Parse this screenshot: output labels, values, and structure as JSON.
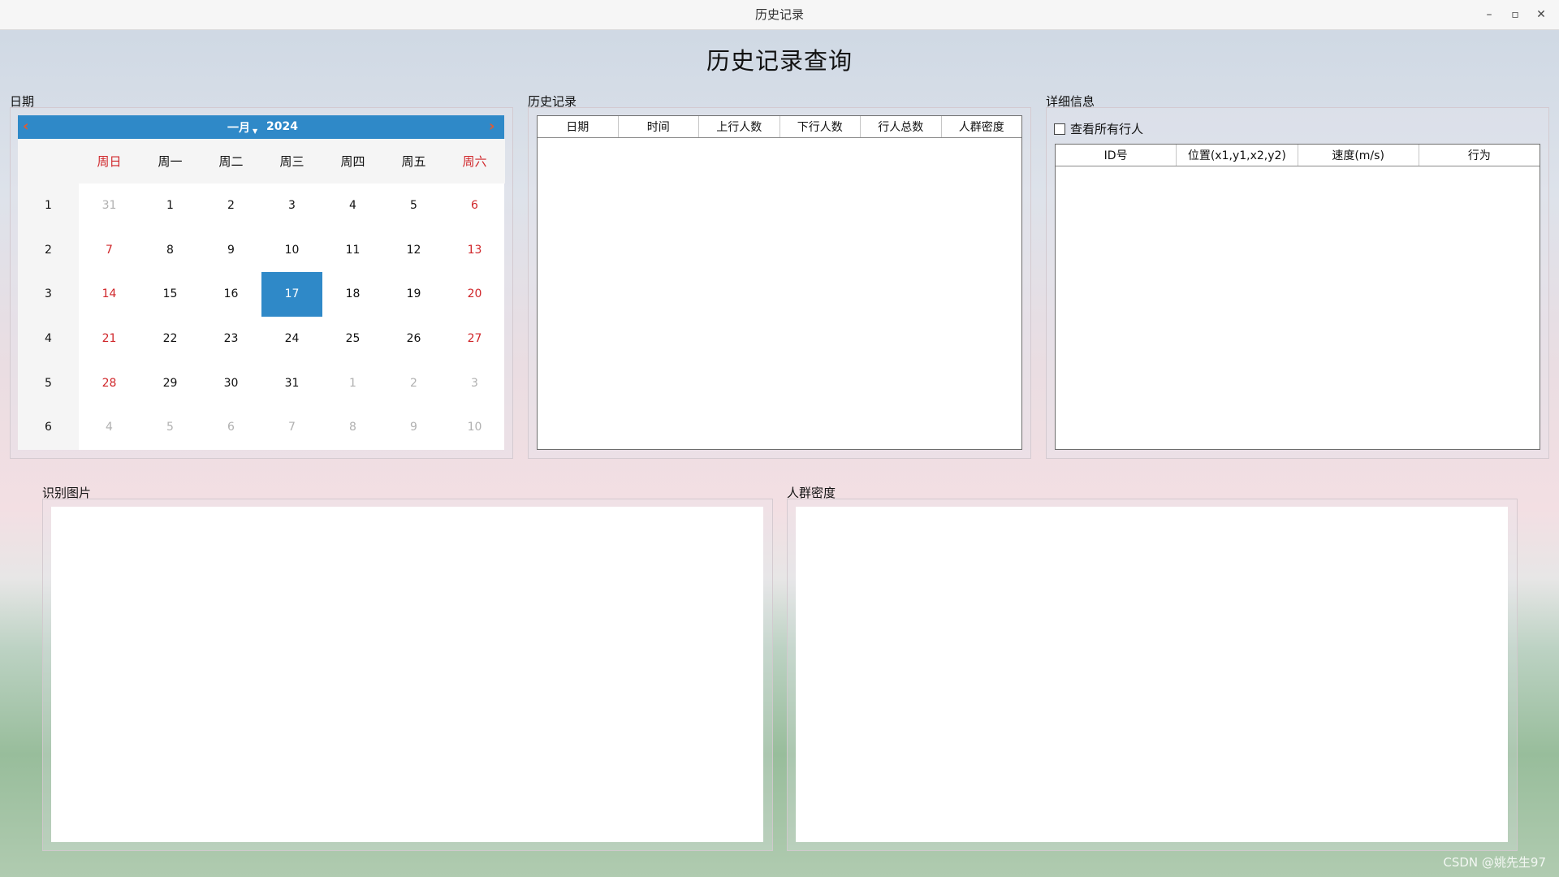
{
  "window": {
    "title": "历史记录",
    "minimize_glyph": "–",
    "restore_glyph": "▫",
    "close_glyph": "✕"
  },
  "page_title": "历史记录查询",
  "date_group": {
    "label": "日期",
    "calendar": {
      "prev_glyph": "‹",
      "next_glyph": "›",
      "month": "一月",
      "year": "2024",
      "weekday_headers": [
        "周日",
        "周一",
        "周二",
        "周三",
        "周四",
        "周五",
        "周六"
      ],
      "week_numbers": [
        "1",
        "2",
        "3",
        "4",
        "5",
        "6"
      ],
      "days": [
        [
          "31",
          "1",
          "2",
          "3",
          "4",
          "5",
          "6"
        ],
        [
          "7",
          "8",
          "9",
          "10",
          "11",
          "12",
          "13"
        ],
        [
          "14",
          "15",
          "16",
          "17",
          "18",
          "19",
          "20"
        ],
        [
          "21",
          "22",
          "23",
          "24",
          "25",
          "26",
          "27"
        ],
        [
          "28",
          "29",
          "30",
          "31",
          "1",
          "2",
          "3"
        ],
        [
          "4",
          "5",
          "6",
          "7",
          "8",
          "9",
          "10"
        ]
      ],
      "selected_day": "17",
      "accent_color": "#2f89c8",
      "weekend_color": "#d0262a"
    }
  },
  "history_group": {
    "label": "历史记录",
    "columns": [
      "日期",
      "时间",
      "上行人数",
      "下行人数",
      "行人总数",
      "人群密度"
    ]
  },
  "detail_group": {
    "label": "详细信息",
    "show_all_label": "查看所有行人",
    "columns": [
      "ID号",
      "位置(x1,y1,x2,y2)",
      "速度(m/s)",
      "行为"
    ]
  },
  "recognition_group": {
    "label": "识别图片"
  },
  "density_group": {
    "label": "人群密度"
  },
  "watermark": "CSDN @姚先生97"
}
